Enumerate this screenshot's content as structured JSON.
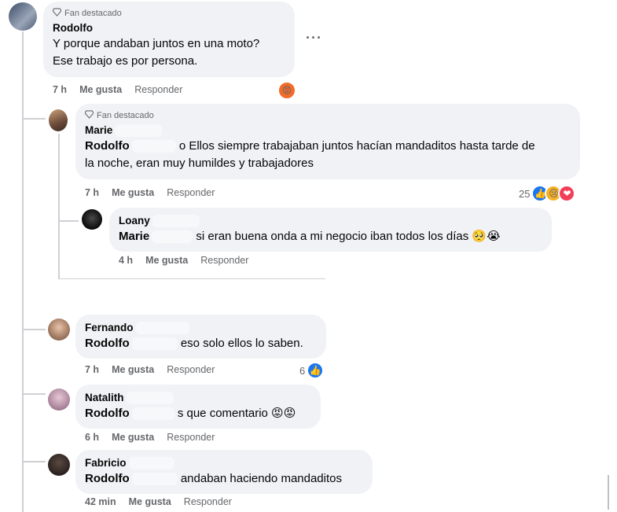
{
  "comments": [
    {
      "badge": "Fan destacado",
      "author": "Rodolfo",
      "text_line1": "Y porque andaban juntos en una moto?",
      "text_line2": "Ese trabajo es por persona.",
      "time": "7 h",
      "like": "Me gusta",
      "reply": "Responder",
      "reaction_icon": "angry-emoji"
    },
    {
      "badge": "Fan destacado",
      "author": "Marie",
      "mention": "Rodolfo",
      "text_line1": "o Ellos siempre trabajaban juntos hacían mandaditos hasta tarde de",
      "text_line2": "la noche, eran muy humildes y trabajadores",
      "time": "7 h",
      "like": "Me gusta",
      "reply": "Responder",
      "reaction_count": "25"
    },
    {
      "author": "Loany",
      "mention": "Marie",
      "text": "si eran buena onda a mi negocio iban todos los días 🥺😭",
      "time": "4 h",
      "like": "Me gusta",
      "reply": "Responder"
    },
    {
      "author": "Fernando",
      "mention": "Rodolfo",
      "text": "eso solo ellos lo saben.",
      "time": "7 h",
      "like": "Me gusta",
      "reply": "Responder",
      "reaction_count": "6"
    },
    {
      "author": "Natalith",
      "mention": "Rodolfo",
      "text": "s que comentario 😡😡",
      "time": "6 h",
      "like": "Me gusta",
      "reply": "Responder"
    },
    {
      "author": "Fabricio",
      "mention": "Rodolfo",
      "text": "andaban haciendo mandaditos",
      "time": "42 min",
      "like": "Me gusta",
      "reply": "Responder"
    }
  ],
  "more_label": "···",
  "colors": {
    "bubble": "#f0f2f5",
    "meta": "#65676b",
    "like_blue": "#1877f2",
    "love_red": "#f33e58",
    "angry": "#e9710f"
  }
}
